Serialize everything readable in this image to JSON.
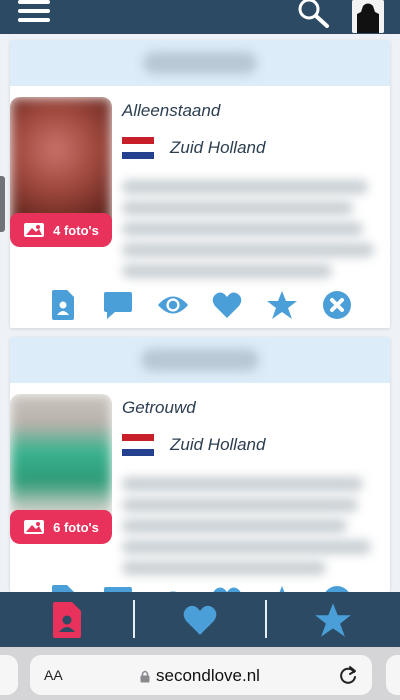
{
  "colors": {
    "topbar": "#2c4a63",
    "card_header": "#dcecf8",
    "accent_pink": "#e8315b",
    "action_blue": "#4a9fd8"
  },
  "header": {
    "menu_icon": "hamburger-icon",
    "search_icon": "search-icon",
    "avatar_icon": "avatar"
  },
  "profiles": [
    {
      "relationship_status": "Alleenstaand",
      "region": "Zuid Holland",
      "photo_count_label": "4 foto's",
      "flag": "netherlands-flag"
    },
    {
      "relationship_status": "Getrouwd",
      "region": "Zuid Holland",
      "photo_count_label": "6 foto's",
      "flag": "netherlands-flag"
    }
  ],
  "card_actions": [
    "profile-icon",
    "message-icon",
    "view-icon",
    "heart-icon",
    "star-icon",
    "close-icon"
  ],
  "bottom_nav": [
    "profile-icon",
    "heart-icon",
    "star-icon"
  ],
  "browser": {
    "text_size_label": "AA",
    "url": "secondlove.nl"
  }
}
